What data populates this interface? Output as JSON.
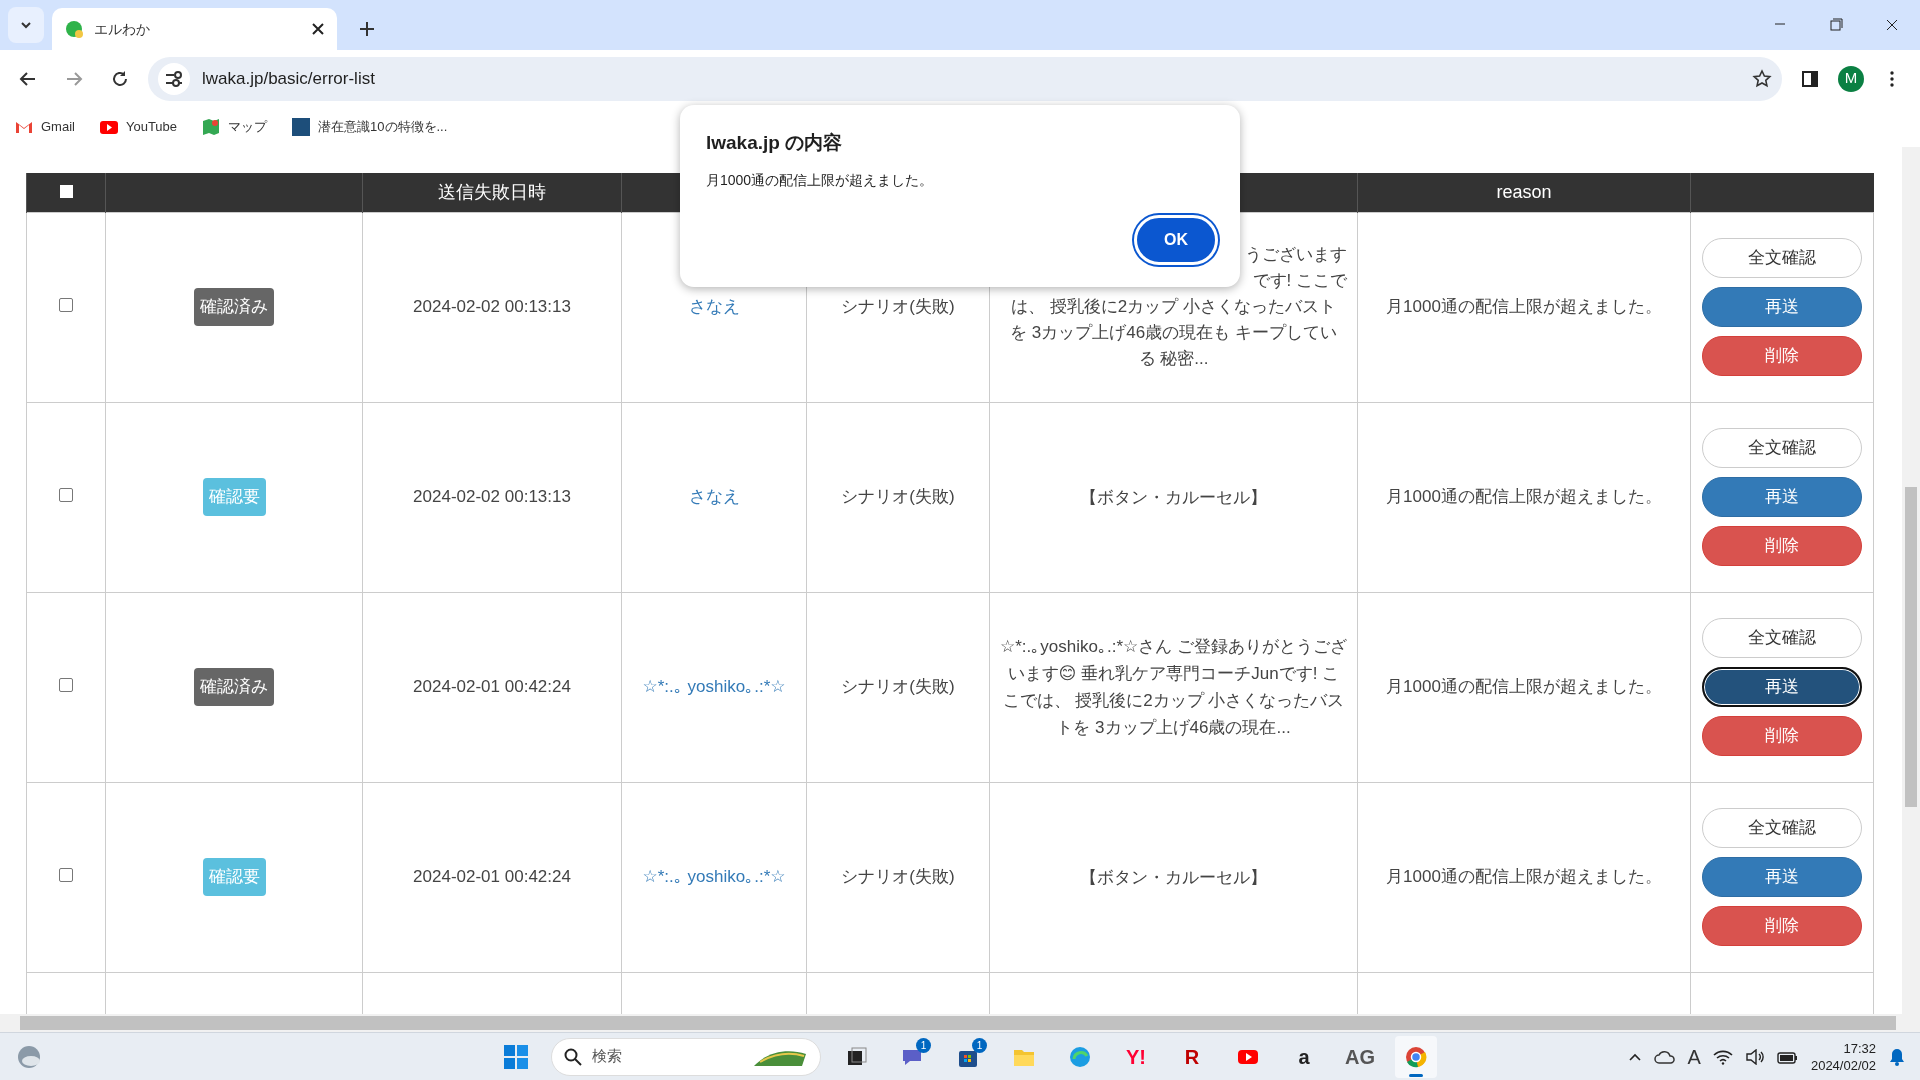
{
  "browser": {
    "tabs": [
      {
        "title": "エルわか",
        "selected": true
      }
    ],
    "address": "lwaka.jp/basic/error-list",
    "profile_initial": "M",
    "bookmarks": [
      {
        "kind": "gmail",
        "label": "Gmail"
      },
      {
        "kind": "youtube",
        "label": "YouTube"
      },
      {
        "kind": "maps",
        "label": "マップ"
      },
      {
        "kind": "site",
        "label": "潜在意識10の特徴を..."
      }
    ]
  },
  "table": {
    "header": {
      "select_all_checked": false,
      "failed_at": "送信失敗日時",
      "reason": "reason"
    },
    "rows": [
      {
        "checked": false,
        "status": {
          "label": "確認済み",
          "kind": "done"
        },
        "failed_at": "2024-02-02 00:13:13",
        "name": "さなえ",
        "type": "シナリオ(失敗)",
        "message_lines": [
          {
            "text": "うございます",
            "covered": true
          },
          {
            "text": "です! ここで",
            "covered": true
          },
          {
            "text": "は、 授乳後に2カップ 小さくなったバスト"
          },
          {
            "text": "を 3カップ上げ46歳の現在も キープしてい"
          },
          {
            "text": "る 秘密..."
          }
        ],
        "reason": "月1000通の配信上限が超えました。",
        "actions": [
          {
            "label": "全文確認",
            "kind": "outline",
            "focused": false
          },
          {
            "label": "再送",
            "kind": "primary",
            "focused": false
          },
          {
            "label": "削除",
            "kind": "danger",
            "focused": false
          }
        ]
      },
      {
        "checked": false,
        "status": {
          "label": "確認要",
          "kind": "needed"
        },
        "failed_at": "2024-02-02 00:13:13",
        "name": "さなえ",
        "type": "シナリオ(失敗)",
        "message": "【ボタン・カルーセル】",
        "reason": "月1000通の配信上限が超えました。",
        "actions": [
          {
            "label": "全文確認",
            "kind": "outline",
            "focused": false
          },
          {
            "label": "再送",
            "kind": "primary",
            "focused": false
          },
          {
            "label": "削除",
            "kind": "danger",
            "focused": false
          }
        ]
      },
      {
        "checked": false,
        "status": {
          "label": "確認済み",
          "kind": "done"
        },
        "failed_at": "2024-02-01 00:42:24",
        "name": "☆*:.｡ yoshiko｡.:*☆",
        "type": "シナリオ(失敗)",
        "message": "☆*:.｡yoshiko｡.:*☆さん ご登録ありがとうございます😊 垂れ乳ケア専門コーチJunです! ここでは、 授乳後に2カップ 小さくなったバストを 3カップ上げ46歳の現在...",
        "reason": "月1000通の配信上限が超えました。",
        "actions": [
          {
            "label": "全文確認",
            "kind": "outline",
            "focused": false
          },
          {
            "label": "再送",
            "kind": "primary",
            "focused": true
          },
          {
            "label": "削除",
            "kind": "danger",
            "focused": false
          }
        ]
      },
      {
        "checked": false,
        "status": {
          "label": "確認要",
          "kind": "needed"
        },
        "failed_at": "2024-02-01 00:42:24",
        "name": "☆*:.｡ yoshiko｡.:*☆",
        "type": "シナリオ(失敗)",
        "message": "【ボタン・カルーセル】",
        "reason": "月1000通の配信上限が超えました。",
        "actions": [
          {
            "label": "全文確認",
            "kind": "outline",
            "focused": false
          },
          {
            "label": "再送",
            "kind": "primary",
            "focused": false
          },
          {
            "label": "削除",
            "kind": "danger",
            "focused": false
          }
        ]
      }
    ]
  },
  "dialog": {
    "title": "lwaka.jp の内容",
    "message": "月1000通の配信上限が超えました。",
    "ok": "OK"
  },
  "taskbar": {
    "search_placeholder": "検索",
    "apps": [
      {
        "kind": "taskview",
        "active": false
      },
      {
        "kind": "chat",
        "badge": "1",
        "active": false
      },
      {
        "kind": "store",
        "badge": "1",
        "active": false
      },
      {
        "kind": "folder",
        "active": false
      },
      {
        "kind": "edge",
        "active": false
      },
      {
        "kind": "yahoo",
        "label": "Y!",
        "active": false
      },
      {
        "kind": "rakuten",
        "label": "R",
        "active": false
      },
      {
        "kind": "youtube",
        "active": false
      },
      {
        "kind": "amazon",
        "label": "a",
        "active": false
      },
      {
        "kind": "ag",
        "label": "AG",
        "active": false
      },
      {
        "kind": "chrome",
        "active": true
      }
    ],
    "ime": "A",
    "time": "17:32",
    "date": "2024/02/02"
  }
}
